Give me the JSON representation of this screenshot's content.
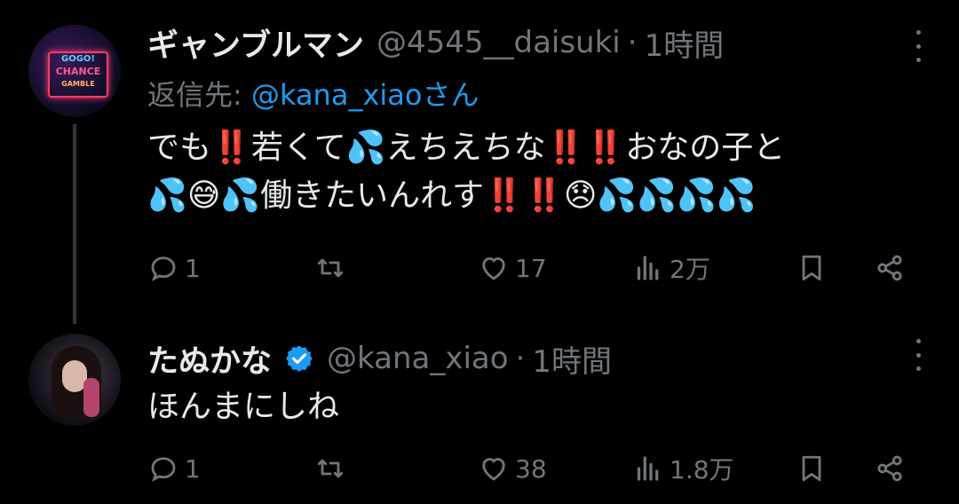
{
  "tweets": [
    {
      "display_name": "ギャンブルマン",
      "handle": "@4545__daisuki",
      "separator": "·",
      "time": "1時間",
      "reply_prefix": "返信先: ",
      "reply_mention": "@kana_xiaoさん",
      "avatar_text": [
        "GOGO!",
        "CHANCE",
        "GAMBLE"
      ],
      "line1": "でも‼️若くて💦えちえちな‼️‼️おなの子と",
      "line2": "💦😅💦働きたいんれす‼️‼️😞💦💦💦💦",
      "actions": {
        "replies": "1",
        "likes": "17",
        "views": "2万"
      }
    },
    {
      "display_name": "たぬかな",
      "verified": true,
      "handle": "@kana_xiao",
      "separator": "·",
      "time": "1時間",
      "body": "ほんまにしね",
      "actions": {
        "replies": "1",
        "likes": "38",
        "views": "1.8万"
      }
    }
  ],
  "colors": {
    "accent": "#1d9bf0",
    "muted": "#71767b",
    "text": "#e7e9ea",
    "background": "#000000"
  }
}
